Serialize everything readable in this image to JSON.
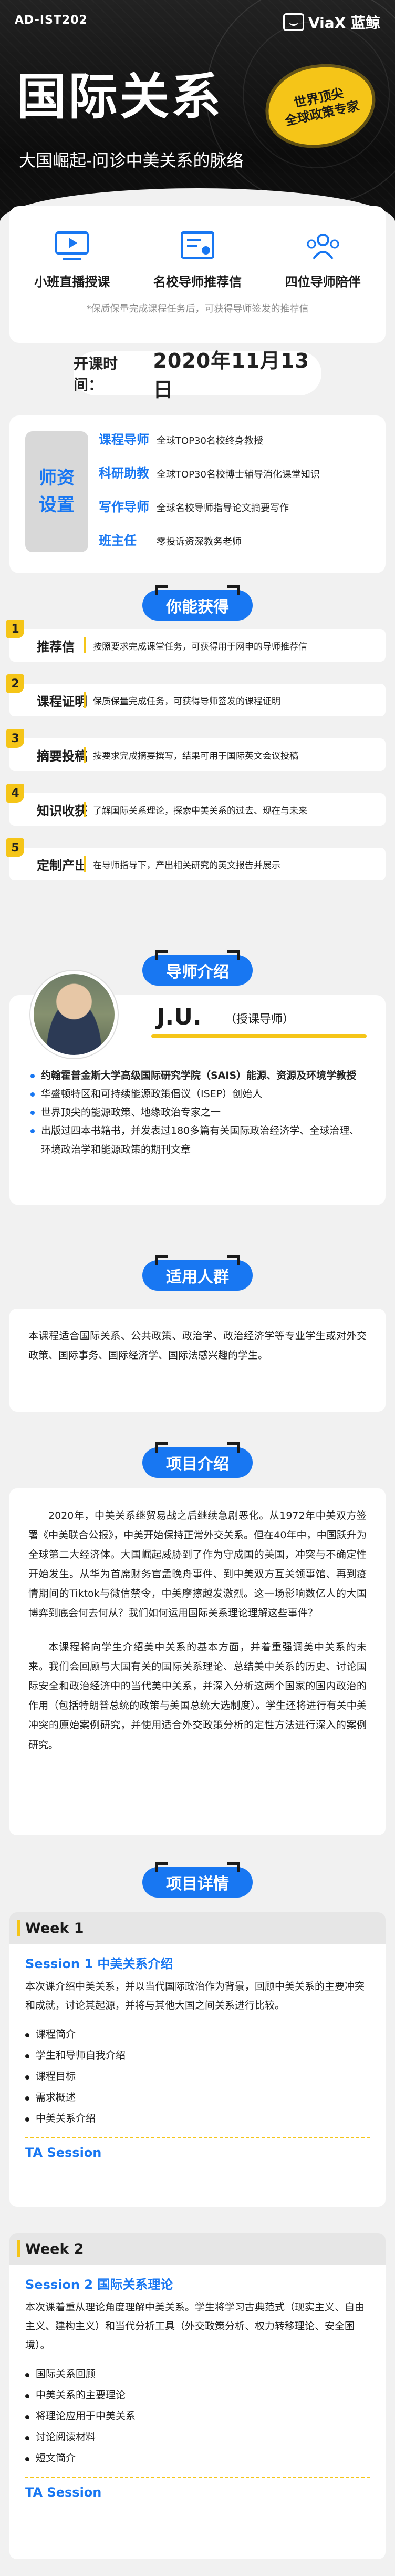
{
  "header": {
    "code": "AD-IST202",
    "logo_text": "ViaX 蓝鲸",
    "title": "国际关系",
    "subtitle": "大国崛起-问诊中美关系的脉络",
    "badge_line1": "世界顶尖",
    "badge_line2": "全球政策专家"
  },
  "features": {
    "items": [
      {
        "icon": "video-icon",
        "label": "小班直播授课"
      },
      {
        "icon": "certificate-icon",
        "label": "名校导师推荐信"
      },
      {
        "icon": "group-icon",
        "label": "四位导师陪伴"
      }
    ],
    "note": "*保质保量完成课程任务后，可获得导师签发的推荐信"
  },
  "date": {
    "label": "开课时间：",
    "value": "2020年11月13日"
  },
  "team": {
    "side_line1": "师资",
    "side_line2": "设置",
    "rows": [
      {
        "k": "课程导师",
        "v": "全球TOP30名校终身教授"
      },
      {
        "k": "科研助教",
        "v": "全球TOP30名校博士辅导消化课堂知识"
      },
      {
        "k": "写作导师",
        "v": "全球名校导师指导论文摘要写作"
      },
      {
        "k": "班主任",
        "v": "零投诉资深教务老师"
      }
    ]
  },
  "sections": {
    "gains": "你能获得",
    "tutor": "导师介绍",
    "audience": "适用人群",
    "project": "项目介绍",
    "details": "项目详情"
  },
  "gains": [
    {
      "num": "1",
      "k": "推荐信",
      "v": "按照要求完成课堂任务，可获得用于网申的导师推荐信"
    },
    {
      "num": "2",
      "k": "课程证明",
      "v": "保质保量完成任务，可获得导师签发的课程证明"
    },
    {
      "num": "3",
      "k": "摘要投稿",
      "v": "按要求完成摘要撰写，结果可用于国际英文会议投稿"
    },
    {
      "num": "4",
      "k": "知识收获",
      "v": "了解国际关系理论，探索中美关系的过去、现在与未来"
    },
    {
      "num": "5",
      "k": "定制产出",
      "v": "在导师指导下，产出相关研究的英文报告并展示"
    }
  ],
  "tutor": {
    "name": "J.U.",
    "role": "（授课导师）",
    "items": [
      "约翰霍普金斯大学高级国际研究学院（SAIS）能源、资源及环境学教授",
      "华盛顿特区和可持续能源政策倡议（ISEP）创始人",
      "世界顶尖的能源政策、地缘政治专家之一",
      "出版过四本书籍书，并发表过180多篇有关国际政治经济学、全球治理、环境政治学和能源政策的期刊文章"
    ]
  },
  "audience": {
    "text": "本课程适合国际关系、公共政策、政治学、政治经济学等专业学生或对外交政策、国际事务、国际经济学、国际法感兴趣的学生。"
  },
  "project": {
    "p1": "2020年，中美关系继贸易战之后继续急剧恶化。从1972年中美双方签署《中美联合公报》，中美开始保持正常外交关系。但在40年中，中国跃升为全球第二大经济体。大国崛起威胁到了作为守成国的美国，冲突与不确定性开始发生。从华为首席财务官孟晚舟事件、到中美双方互关领事馆、再到疫情期间的Tiktok与微信禁令，中美摩擦越发激烈。这一场影响数亿人的大国博弈到底会何去何从？我们如何运用国际关系理论理解这些事件？",
    "p2": "本课程将向学生介绍美中关系的基本方面，并着重强调美中关系的未来。我们会回顾与大国有关的国际关系理论、总结美中关系的历史、讨论国际安全和政治经济中的当代美中关系，并深入分析这两个国家的国内政治的作用（包括特朗普总统的政策与美国总统大选制度）。学生还将进行有关中美冲突的原始案例研究，并使用适合外交政策分析的定性方法进行深入的案例研究。"
  },
  "weeks": [
    {
      "label": "Week 1",
      "session": "Session 1 中美关系介绍",
      "desc": "本次课介绍中美关系，并以当代国际政治作为背景，回顾中美关系的主要冲突和成就，讨论其起源，并将与其他大国之间关系进行比较。",
      "items": [
        "课程简介",
        "学生和导师自我介绍",
        "课程目标",
        "需求概述",
        "中美关系介绍"
      ],
      "ta": "TA Session"
    },
    {
      "label": "Week 2",
      "session": "Session 2 国际关系理论",
      "desc": "本次课着重从理论角度理解中美关系。学生将学习古典范式（现实主义、自由主义、建构主义）和当代分析工具（外交政策分析、权力转移理论、安全困境）。",
      "items": [
        "国际关系回顾",
        "中美关系的主要理论",
        "将理论应用于中美关系",
        "讨论阅读材料",
        "短文简介"
      ],
      "ta": "TA Session"
    }
  ],
  "colors": {
    "blue": "#1877f2",
    "yellow": "#f5c518",
    "dark": "#111111"
  }
}
